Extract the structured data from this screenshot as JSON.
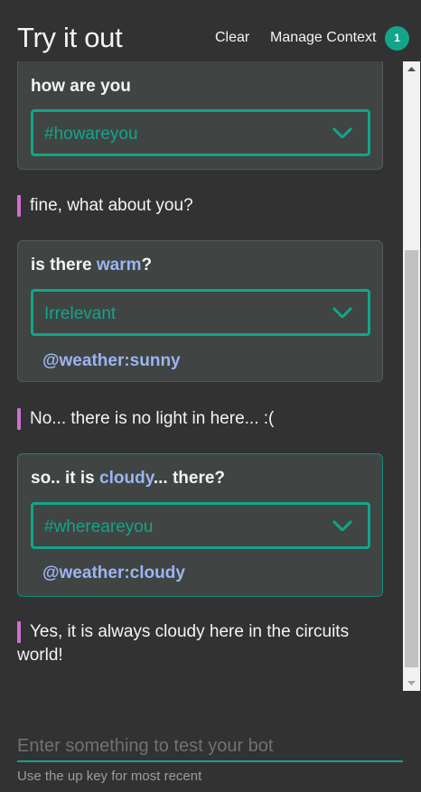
{
  "header": {
    "title": "Try it out",
    "clear_label": "Clear",
    "manage_context_label": "Manage Context",
    "context_count": "1"
  },
  "conversation": [
    {
      "type": "user",
      "q_pre": "how are you",
      "q_hl": "",
      "q_post": "",
      "intent": "#howareyou",
      "entity": ""
    },
    {
      "type": "bot",
      "text": "fine, what about you?"
    },
    {
      "type": "user",
      "q_pre": "is there ",
      "q_hl": "warm",
      "q_post": "?",
      "intent": "Irrelevant",
      "entity": "@weather:sunny"
    },
    {
      "type": "bot",
      "text": "No... there is no light in here... :("
    },
    {
      "type": "user",
      "q_pre": "so.. it is ",
      "q_hl": "cloudy",
      "q_post": "... there?",
      "intent": "#whereareyou",
      "entity": "@weather:cloudy"
    },
    {
      "type": "bot",
      "text": "Yes, it is always cloudy here in the circuits world!"
    }
  ],
  "input": {
    "placeholder": "Enter something to test your bot",
    "value": "",
    "hint": "Use the up key for most recent"
  },
  "colors": {
    "accent": "#12a58a",
    "entity": "#9bb5f2",
    "bot_bar": "#cf6fd3"
  },
  "icons": [
    "chevron-down-icon",
    "scroll-up-arrow-icon",
    "scroll-down-arrow-icon"
  ]
}
